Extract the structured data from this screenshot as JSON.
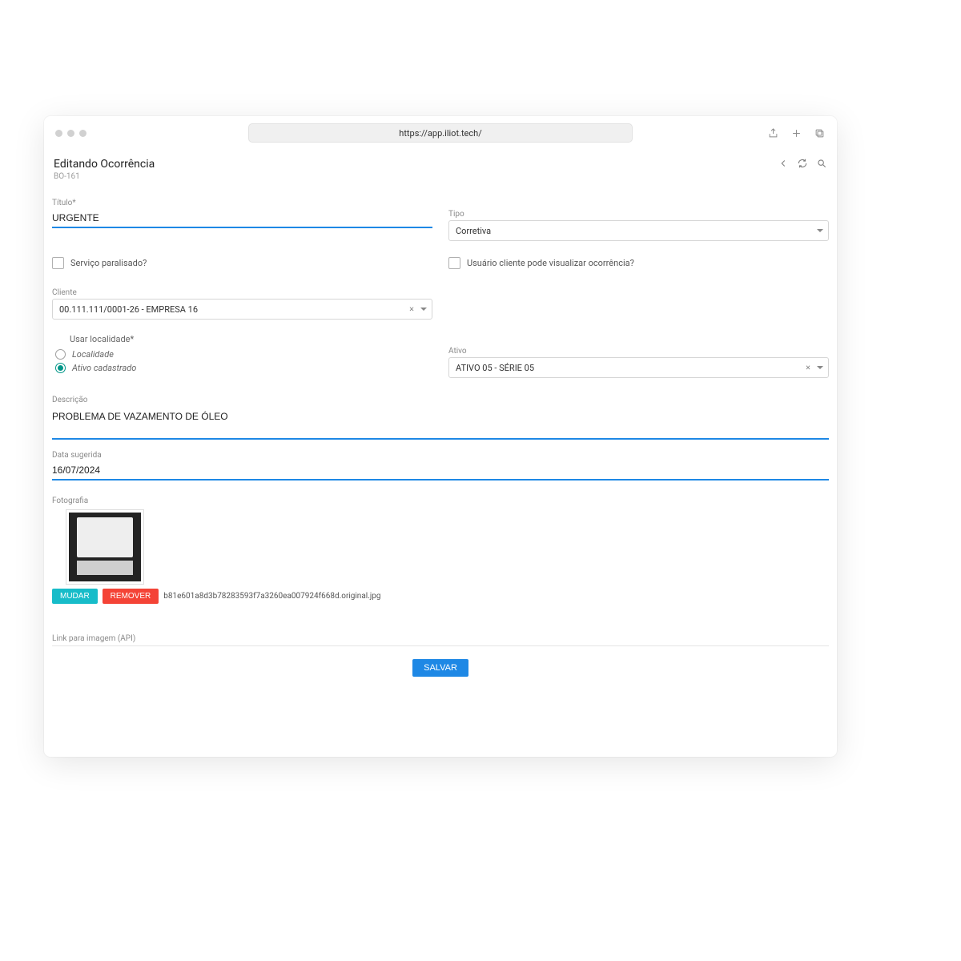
{
  "browser": {
    "url": "https://app.iliot.tech/"
  },
  "header": {
    "title": "Editando Ocorrência",
    "code": "BO-161"
  },
  "form": {
    "titulo_label": "Título*",
    "titulo_value": "URGENTE",
    "tipo_label": "Tipo",
    "tipo_value": "Corretiva",
    "servico_paralisado_label": "Serviço paralisado?",
    "usuario_cliente_label": "Usuário cliente pode visualizar ocorrência?",
    "cliente_label": "Cliente",
    "cliente_value": "00.111.111/0001-26 - EMPRESA 16",
    "usar_localidade_label": "Usar localidade*",
    "radio_localidade": "Localidade",
    "radio_ativo": "Ativo cadastrado",
    "ativo_label": "Ativo",
    "ativo_value": "ATIVO 05 - SÉRIE 05",
    "descricao_label": "Descrição",
    "descricao_value": "PROBLEMA DE VAZAMENTO DE ÓLEO",
    "data_sugerida_label": "Data sugerida",
    "data_sugerida_value": "16/07/2024",
    "fotografia_label": "Fotografia",
    "btn_mudar": "MUDAR",
    "btn_remover": "REMOVER",
    "filename": "b81e601a8d3b78283593f7a3260ea007924f668d.original.jpg",
    "link_api_label": "Link para imagem (API)",
    "btn_salvar": "SALVAR"
  }
}
